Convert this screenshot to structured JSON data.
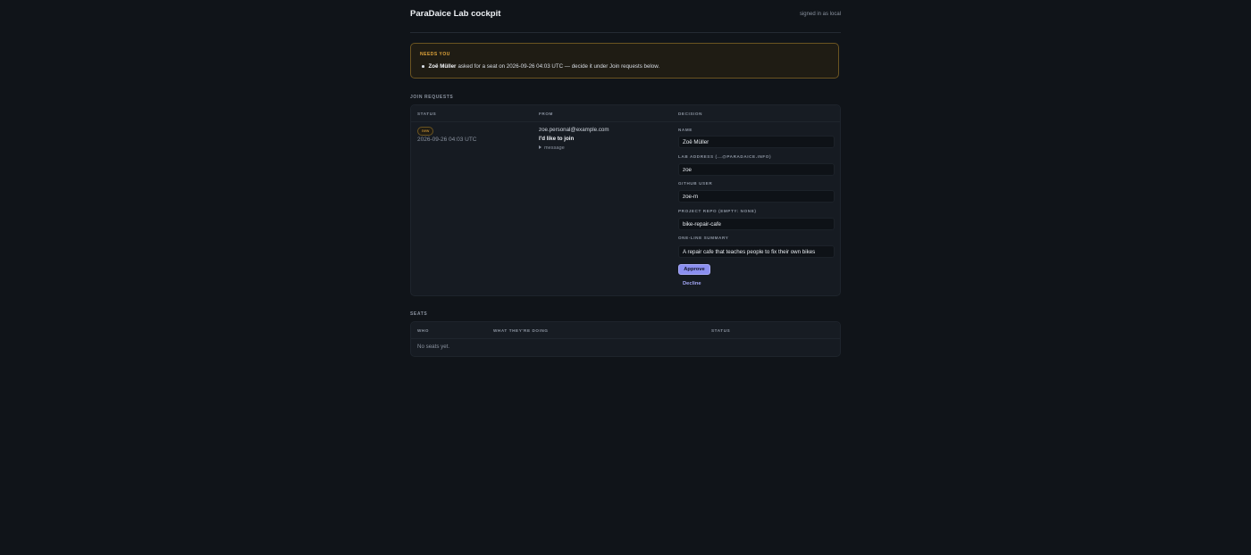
{
  "header": {
    "title": "ParaDaice Lab cockpit",
    "signed_in": "signed in as local"
  },
  "alert": {
    "title": "NEEDS YOU",
    "name": "Zoë Müller",
    "message": "asked for a seat on 2026-09-26 04:03 UTC — decide it under Join requests below."
  },
  "join_requests": {
    "section_label": "JOIN REQUESTS",
    "columns": [
      "STATUS",
      "FROM",
      "DECISION"
    ],
    "rows": [
      {
        "status_badge": "new",
        "timestamp": "2026-09-26 04:03 UTC",
        "from_email": "zoe.personal@example.com",
        "subject": "I'd like to join",
        "message_toggle": "message",
        "fields": [
          {
            "label": "NAME",
            "value": "Zoë Müller"
          },
          {
            "label": "LAB ADDRESS (...@PARADAICE.INFO)",
            "value": "zoe"
          },
          {
            "label": "GITHUB USER",
            "value": "zoe-m"
          },
          {
            "label": "PROJECT REPO (EMPTY: NONE)",
            "value": "bike-repair-cafe"
          },
          {
            "label": "ONE-LINE SUMMARY",
            "value": "A repair cafe that teaches people to fix their own bikes"
          }
        ],
        "approve_label": "Approve",
        "decline_label": "Decline"
      }
    ]
  },
  "seats": {
    "section_label": "SEATS",
    "columns": [
      "WHO",
      "WHAT THEY'RE DOING",
      "STATUS"
    ],
    "empty_text": "No seats yet."
  },
  "colors": {
    "background": "#101419",
    "panel": "#161b22",
    "alert_border": "#6b5421",
    "alert_accent": "#e0a43a",
    "primary": "#8b8ff0"
  }
}
